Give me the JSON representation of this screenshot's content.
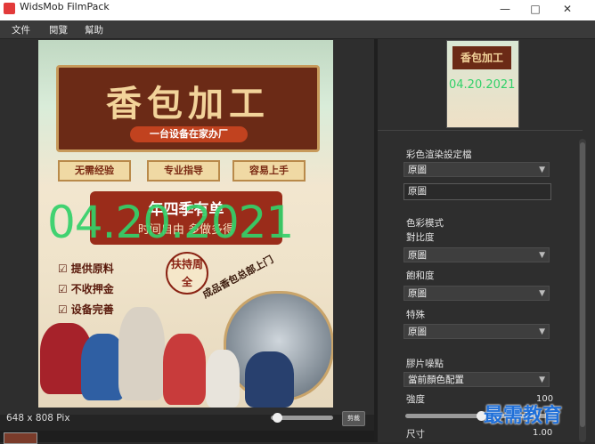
{
  "window": {
    "title": "WidsMob FilmPack"
  },
  "menu": [
    {
      "label": "文件"
    },
    {
      "label": "閱覽"
    },
    {
      "label": "幫助"
    }
  ],
  "canvas": {
    "title": "香包加工",
    "subtitle": "一台设备在家办厂",
    "tags": [
      "无需经验",
      "专业指导",
      "容易上手"
    ],
    "promo_line1": "年四季有单",
    "promo_line2": "时间自由 多做多得",
    "date_overlay": "04.20.2021",
    "checks": [
      "提供原料",
      "不收押金",
      "设备完善"
    ],
    "seal": "扶持周全",
    "diagonal": "成品香包总部上门"
  },
  "status": {
    "image_size": "648 x 808 Pix",
    "fit_label": "剪裁"
  },
  "preview": {
    "title": "香包加工",
    "date": "04.20.2021"
  },
  "panel": {
    "preset_label": "彩色渲染設定檔",
    "preset_value": "原圖",
    "preset_name": "原圖",
    "color_mode_label": "色彩模式",
    "contrast_label": "對比度",
    "contrast_value": "原圖",
    "saturation_label": "飽和度",
    "saturation_value": "原圖",
    "special_label": "特殊",
    "special_value": "原圖",
    "grain_label": "膠片噪點",
    "grain_value": "當前顏色配置",
    "strength_label": "強度",
    "strength_value": "100",
    "size_label": "尺寸",
    "size_value": "1.00"
  },
  "watermark": "最需教育"
}
